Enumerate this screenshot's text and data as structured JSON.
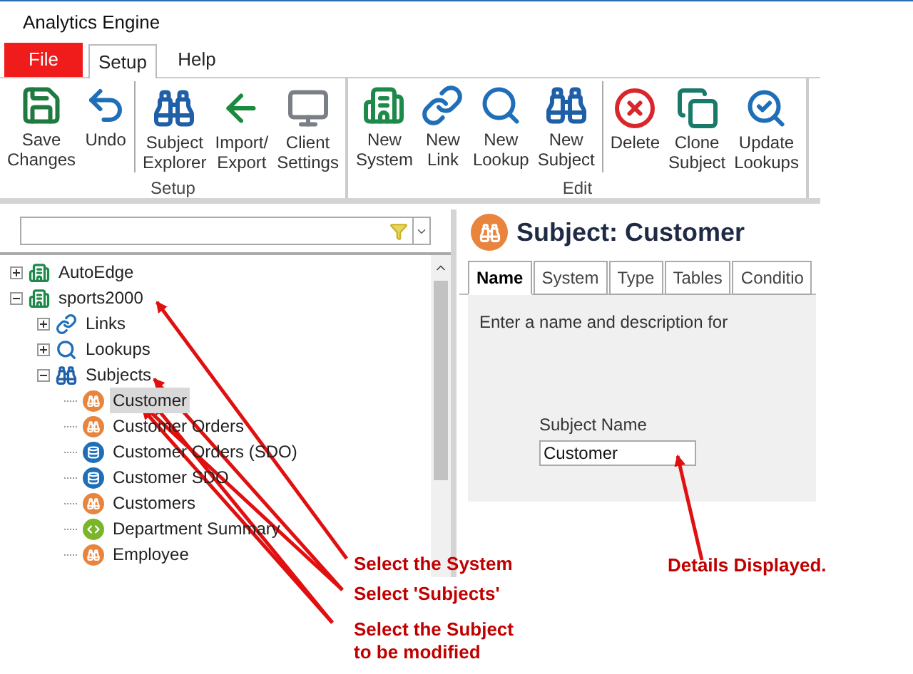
{
  "window": {
    "title": "Analytics Engine"
  },
  "file_button": "File",
  "menu_tabs": [
    {
      "label": "Setup",
      "selected": true
    },
    {
      "label": "Help",
      "selected": false
    }
  ],
  "ribbon": [
    {
      "label": "Setup",
      "sets": [
        [
          {
            "label": "Save\nChanges"
          },
          {
            "label": "Undo"
          }
        ],
        [
          {
            "label": "Subject\nExplorer"
          },
          {
            "label": "Import/\nExport"
          },
          {
            "label": "Client\nSettings"
          }
        ]
      ]
    },
    {
      "label": "Edit",
      "sets": [
        [
          {
            "label": "New\nSystem"
          },
          {
            "label": "New\nLink"
          },
          {
            "label": "New\nLookup"
          },
          {
            "label": "New\nSubject"
          }
        ],
        [
          {
            "label": "Delete"
          },
          {
            "label": "Clone\nSubject"
          },
          {
            "label": "Update\nLookups"
          }
        ]
      ]
    }
  ],
  "tree": [
    {
      "label": "AutoEdge",
      "kind": "system",
      "expanded": false,
      "selected": false
    },
    {
      "label": "sports2000",
      "kind": "system",
      "expanded": true,
      "selected": false,
      "children": [
        {
          "label": "Links",
          "kind": "link",
          "expanded": false,
          "selected": false
        },
        {
          "label": "Lookups",
          "kind": "lookup",
          "expanded": false,
          "selected": false
        },
        {
          "label": "Subjects",
          "kind": "subjects",
          "expanded": true,
          "selected": false,
          "children": [
            {
              "label": "Customer",
              "kind": "subject",
              "selected": true
            },
            {
              "label": "Customer Orders",
              "kind": "subject",
              "selected": false
            },
            {
              "label": "Customer Orders (SDO)",
              "kind": "sdo",
              "selected": false
            },
            {
              "label": "Customer SDO",
              "kind": "sdo",
              "selected": false
            },
            {
              "label": "Customers",
              "kind": "subject",
              "selected": false
            },
            {
              "label": "Department Summary",
              "kind": "summary",
              "selected": false
            },
            {
              "label": "Employee",
              "kind": "subject",
              "selected": false
            }
          ]
        }
      ]
    }
  ],
  "detail": {
    "title": "Subject: Customer",
    "tabs": [
      {
        "label": "Name",
        "selected": true
      },
      {
        "label": "System",
        "selected": false
      },
      {
        "label": "Type",
        "selected": false
      },
      {
        "label": "Tables",
        "selected": false
      },
      {
        "label": "Conditio",
        "selected": false
      }
    ],
    "instructions": "Enter a name and description for",
    "subject_name": {
      "label": "Subject Name",
      "value": "Customer"
    }
  },
  "annotations": [
    "Select the System",
    "Select 'Subjects'",
    "Select the Subject\nto be modified",
    "Details Displayed."
  ]
}
